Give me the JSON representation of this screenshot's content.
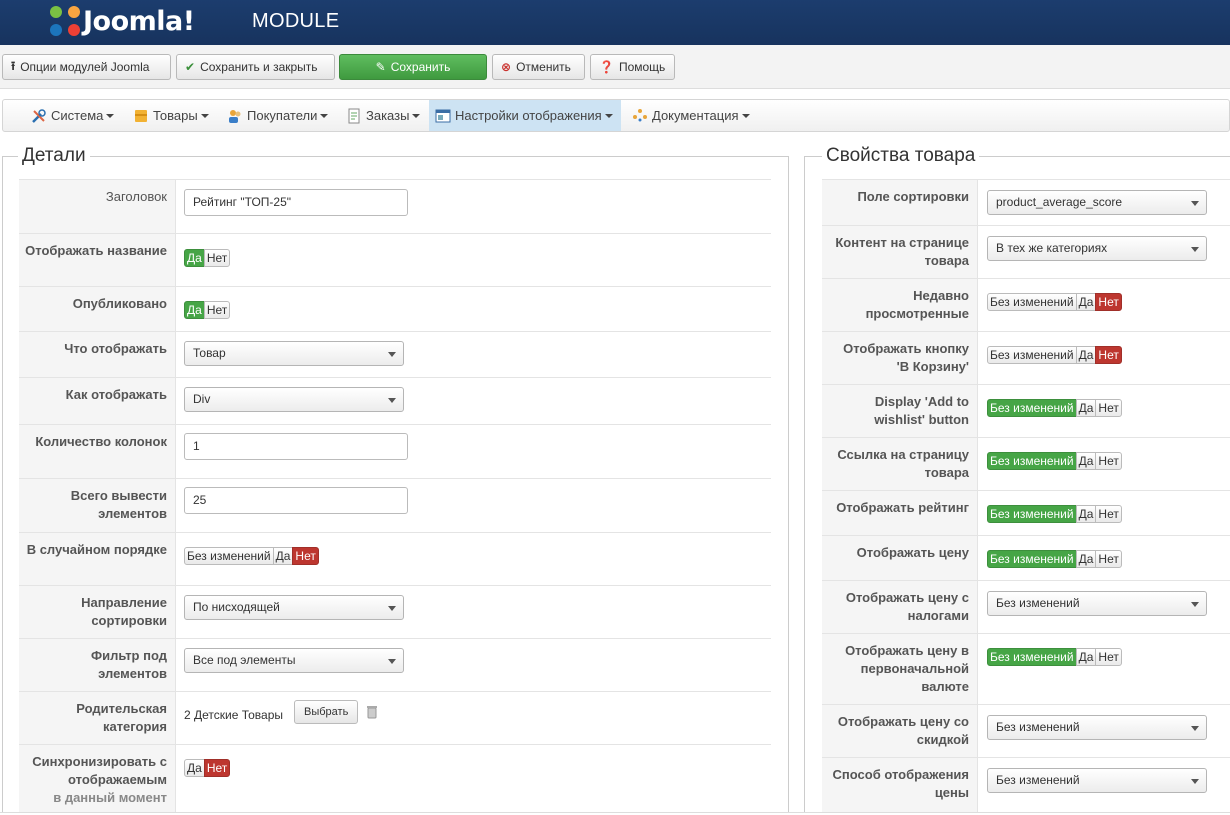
{
  "header": {
    "logo_text": "Joomla!",
    "title": "MODULE"
  },
  "toolbar": {
    "options": "Опции модулей Joomla",
    "save_close": "Сохранить и закрыть",
    "save": "Сохранить",
    "cancel": "Отменить",
    "help": "Помощь"
  },
  "menu": {
    "system": "Система",
    "products": "Товары",
    "customers": "Покупатели",
    "orders": "Заказы",
    "display": "Настройки отображения",
    "docs": "Документация"
  },
  "details": {
    "legend": "Детали",
    "title_label": "Заголовок",
    "title_value": "Рейтинг \"ТОП-25\"",
    "show_name_label": "Отображать название",
    "published_label": "Опубликовано",
    "what_label": "Что отображать",
    "what_value": "Товар",
    "how_label": "Как отображать",
    "how_value": "Div",
    "columns_label": "Количество колонок",
    "columns_value": "1",
    "total_label": "Всего вывести элементов",
    "total_value": "25",
    "random_label": "В случайном порядке",
    "sort_dir_label": "Направление сортировки",
    "sort_dir_value": "По нисходящей",
    "filter_label": "Фильтр под элементов",
    "filter_value": "Все под элементы",
    "parent_label": "Родительская категория",
    "parent_value": "2 Детские Товары",
    "choose_btn": "Выбрать",
    "sync_label_1": "Синхронизировать с отображаемым",
    "sync_label_2": "в данный момент"
  },
  "props": {
    "legend": "Свойства товара",
    "sort_field_label": "Поле сортировки",
    "sort_field_value": "product_average_score",
    "content_label": "Контент на странице товара",
    "content_value": "В тех же категориях",
    "recent_label": "Недавно просмотренные",
    "cart_label": "Отображать кнопку 'В Корзину'",
    "wishlist_label": "Display 'Add to wishlist' button",
    "link_label": "Ссылка на страницу товара",
    "rating_label": "Отображать рейтинг",
    "price_label": "Отображать цену",
    "price_tax_label": "Отображать цену с налогами",
    "price_tax_value": "Без изменений",
    "price_orig_label": "Отображать цену в первоначальной валюте",
    "price_disc_label": "Отображать цену со скидкой",
    "price_disc_value": "Без изменений",
    "price_mode_label": "Способ отображения цены",
    "price_mode_value": "Без изменений"
  },
  "toggle": {
    "yes": "Да",
    "no": "Нет",
    "nochange": "Без изменений"
  },
  "colors": {
    "header": "#1c3d6e",
    "green": "#46a546",
    "red": "#bd362f",
    "active_menu": "#cde3f3"
  }
}
